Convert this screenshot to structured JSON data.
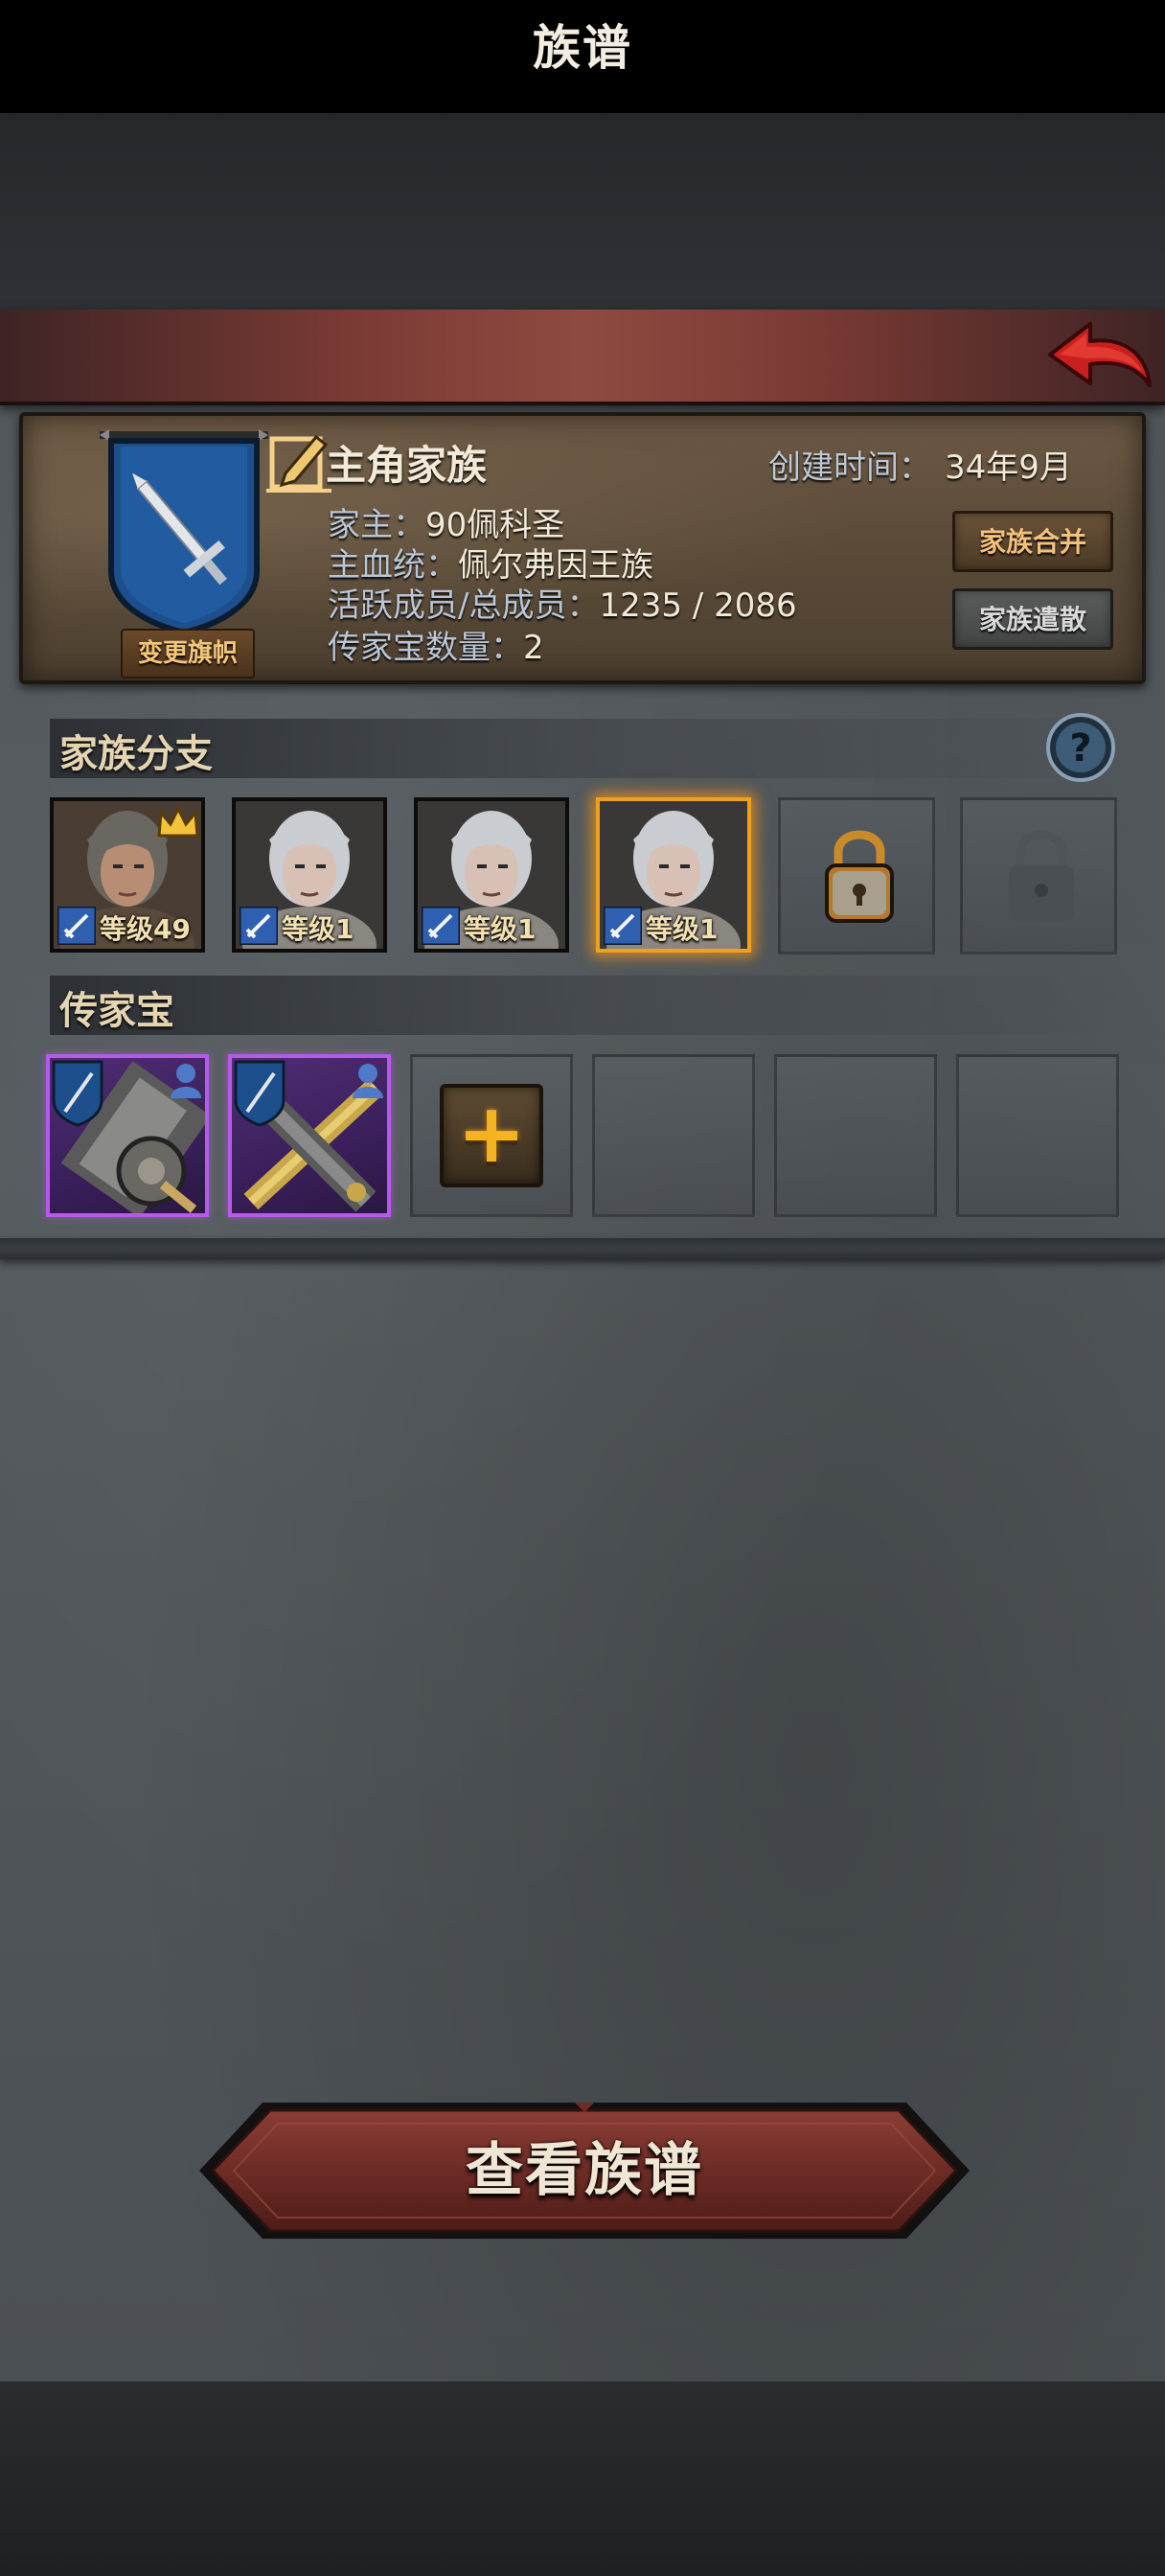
{
  "title": "族谱",
  "family": {
    "name": "主角家族",
    "created_label": "创建时间：",
    "created_value": "34年9月",
    "head_label": "家主：",
    "head_value": "90佩科圣",
    "bloodline_label": "主血统：",
    "bloodline_value": "佩尔弗因王族",
    "members_label": "活跃成员/总成员：",
    "members_value": "1235 / 2086",
    "heirloom_label": "传家宝数量：",
    "heirloom_value": "2",
    "change_banner": "变更旗帜",
    "merge": "家族合并",
    "disband": "家族遣散",
    "banner_icon": "sword-banner-icon",
    "banner_color": "#1d4f8c"
  },
  "branches": {
    "title": "家族分支",
    "members": [
      {
        "level": "等级49",
        "crown": true,
        "selected": false
      },
      {
        "level": "等级1",
        "crown": false,
        "selected": false
      },
      {
        "level": "等级1",
        "crown": false,
        "selected": false
      },
      {
        "level": "等级1",
        "crown": false,
        "selected": true
      }
    ],
    "locked_slots": 2
  },
  "heirlooms": {
    "title": "传家宝",
    "items": [
      {
        "icon": "shield-axe-icon",
        "rarity_color": "#b65ae8"
      },
      {
        "icon": "crossed-swords-icon",
        "rarity_color": "#b65ae8"
      }
    ],
    "add_icon": "plus-icon",
    "add_symbol": "+",
    "empty_slots": 3
  },
  "view_button": "查看族谱",
  "colors": {
    "accent_gold": "#f4c07a",
    "title_red": "#8e4a40",
    "selected_orange": "#f0a020",
    "epic_purple": "#b65ae8"
  }
}
